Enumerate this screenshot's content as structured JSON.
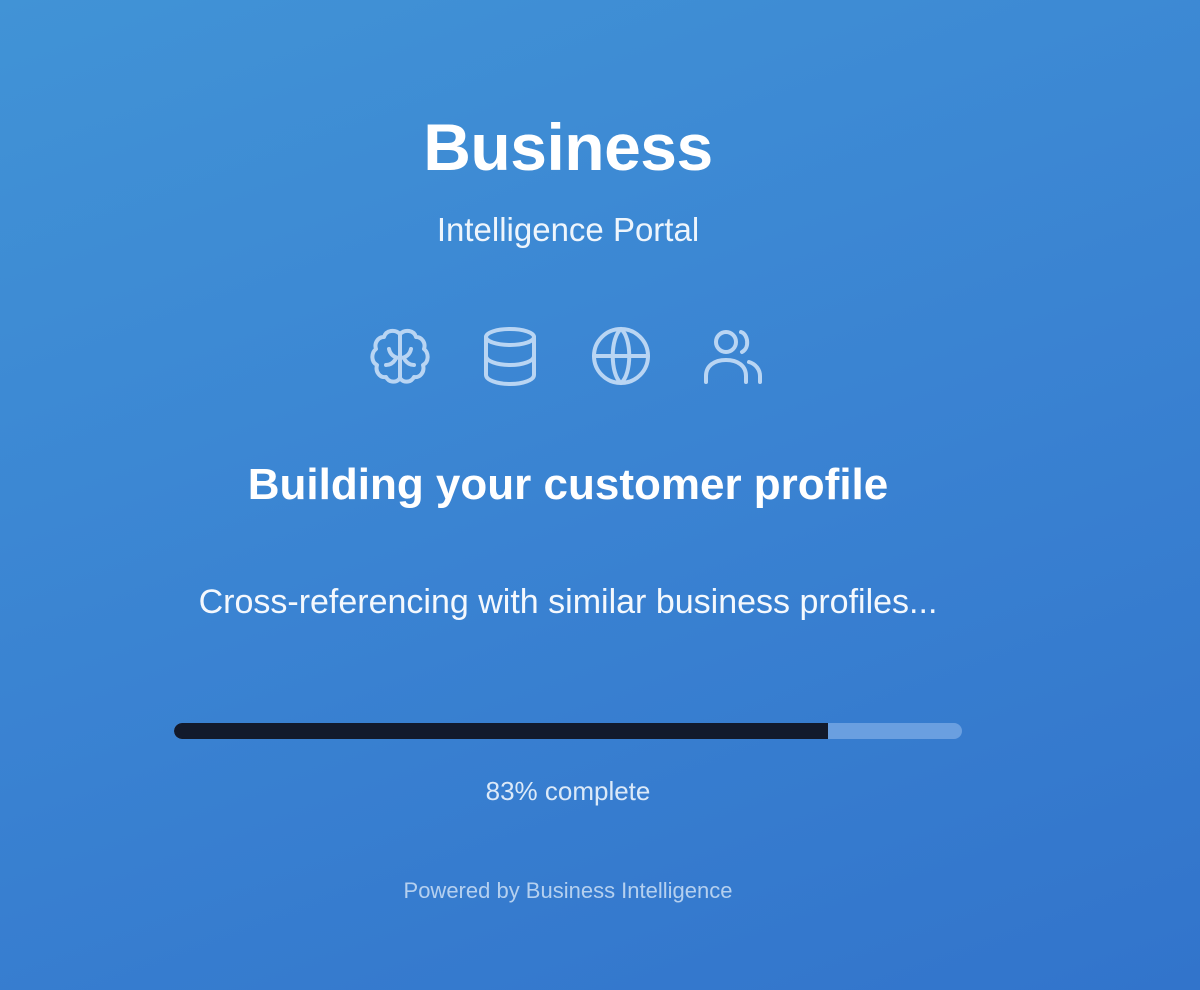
{
  "brand": {
    "title": "Business",
    "subtitle": "Intelligence Portal"
  },
  "icons": [
    "brain-icon",
    "database-icon",
    "globe-icon",
    "users-icon"
  ],
  "status": {
    "heading": "Building your customer profile",
    "message": "Cross-referencing with similar business profiles..."
  },
  "progress": {
    "percent": 83,
    "label": "83% complete"
  },
  "footer": {
    "credit": "Powered by Business Intelligence"
  },
  "colors": {
    "background_start": "#4193d6",
    "background_end": "#3274cb",
    "progress_fill": "#121a2c",
    "progress_track": "#6a9fe0",
    "icon_stroke": "#b9d5f3"
  }
}
